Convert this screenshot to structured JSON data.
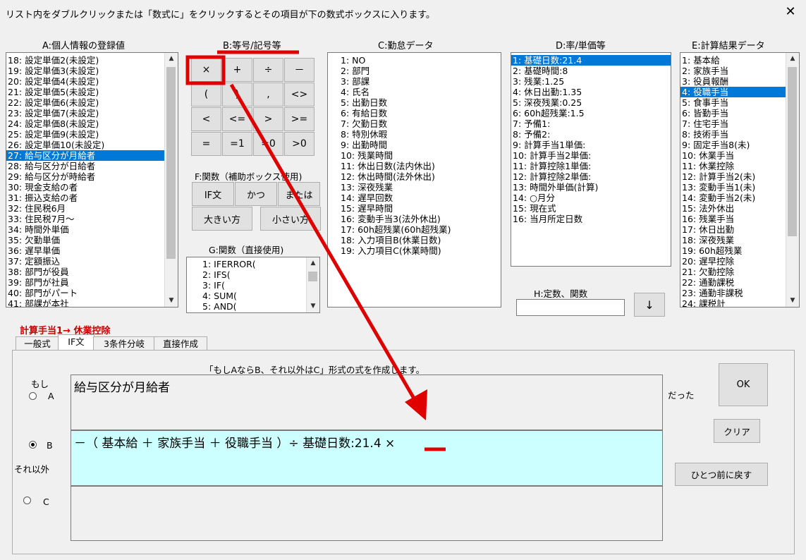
{
  "window": {
    "title": "リスト内をダブルクリックまたは「数式に」をクリックするとその項目が下の数式ボックスに入ります。",
    "close": "✕"
  },
  "listA": {
    "header": "A:個人情報の登録値",
    "items": [
      "18: 設定単価2(未設定)",
      "19: 設定単価3(未設定)",
      "20: 設定単価4(未設定)",
      "21: 設定単価5(未設定)",
      "22: 設定単価6(未設定)",
      "23: 設定単価7(未設定)",
      "24: 設定単価8(未設定)",
      "25: 設定単価9(未設定)",
      "26: 設定単価10(未設定)",
      "27: 給与区分が月給者",
      "28: 給与区分が日給者",
      "29: 給与区分が時給者",
      "30: 現金支給の者",
      "31: 振込支給の者",
      "32: 住民税6月",
      "33: 住民税7月～",
      "34: 時間外単価",
      "35: 欠勤単価",
      "36: 遅早単価",
      "37: 定額振込",
      "38: 部門が役員",
      "39: 部門が社員",
      "40: 部門がパート",
      "41: 部課が本社"
    ],
    "selected": 9
  },
  "groupB": {
    "header": "B:等号/記号等",
    "buttons": [
      "×",
      "+",
      "÷",
      "－",
      "(",
      ")",
      ",",
      "<>",
      "<",
      "<=",
      ">",
      ">=",
      "=",
      "=1",
      "=0",
      ">0"
    ]
  },
  "groupF": {
    "header": "F:関数（補助ボックス使用)",
    "buttons": [
      "IF文",
      "かつ",
      "または",
      "大きい方",
      "小さい方"
    ]
  },
  "groupG": {
    "header": "G:関数（直接使用)",
    "items": [
      "1: IFERROR(",
      "2: IFS(",
      "3: IF(",
      "4: SUM(",
      "5: AND("
    ]
  },
  "listC": {
    "header": "C:勤怠データ",
    "items": [
      "1: NO",
      "2: 部門",
      "3: 部課",
      "4: 氏名",
      "5: 出勤日数",
      "6: 有給日数",
      "7: 欠勤日数",
      "8: 特別休暇",
      "9: 出勤時間",
      "10: 残業時間",
      "11: 休出日数(法内休出)",
      "12: 休出時間(法外休出)",
      "13: 深夜残業",
      "14: 遅早回数",
      "15: 遅早時間",
      "16: 変動手当3(法外休出)",
      "17: 60h超残業(60h超残業)",
      "18: 入力項目B(休業日数)",
      "19: 入力項目C(休業時間)"
    ]
  },
  "listD": {
    "header": "D:率/単価等",
    "items": [
      "1: 基礎日数:21.4",
      "2: 基礎時間:8",
      "3: 残業:1.25",
      "4: 休日出勤:1.35",
      "5: 深夜残業:0.25",
      "6: 60h超残業:1.5",
      "7: 予備1:",
      "8: 予備2:",
      "9: 計算手当1単価:",
      "10: 計算手当2単価:",
      "11: 計算控除1単価:",
      "12: 計算控除2単価:",
      "13: 時間外単価(計算)",
      "14: ○月分",
      "15: 現在式",
      "16: 当月所定日数"
    ],
    "selected": 0
  },
  "groupH": {
    "header": "H:定数、関数",
    "input": "",
    "button": "↓"
  },
  "listE": {
    "header": "E:計算結果データ",
    "items": [
      "1: 基本給",
      "2: 家族手当",
      "3: 役員報酬",
      "4: 役職手当",
      "5: 食事手当",
      "6: 皆勤手当",
      "7: 住宅手当",
      "8: 技術手当",
      "9: 固定手当8(未)",
      "10: 休業手当",
      "11: 休業控除",
      "12: 計算手当2(未)",
      "13: 変動手当1(未)",
      "14: 変動手当2(未)",
      "15: 法外休出",
      "16: 残業手当",
      "17: 休日出勤",
      "18: 深夜残業",
      "19: 60h超残業",
      "20: 遅早控除",
      "21: 欠勤控除",
      "22: 通勤課税",
      "23: 通勤非課税",
      "24: 課税計"
    ],
    "selected": 3
  },
  "target": {
    "label": "計算手当1→ 休業控除",
    "color": "#cc0000"
  },
  "tabs": [
    "一般式",
    "IF文",
    "3条件分岐",
    "直接作成"
  ],
  "activeTab": 1,
  "ifPanel": {
    "description": "「もしAならB、それ以外はC」形式の式を作成します。",
    "if_label": "もし",
    "radioA": "A",
    "radioB": "B",
    "radioC": "C",
    "else_label": "それ以外",
    "then_label": "だった",
    "textA": "給与区分が月給者",
    "textB": "－（ 基本給 ＋ 家族手当 ＋ 役職手当 ）÷ 基礎日数:21.4 ×",
    "textC": "",
    "selectedRadio": "B",
    "ok": "OK",
    "clear": "クリア",
    "undo": "ひとつ前に戻す"
  },
  "colors": {
    "selection": "#0078d7",
    "highlightBox": "#ccffff",
    "annotation": "#e00000"
  }
}
